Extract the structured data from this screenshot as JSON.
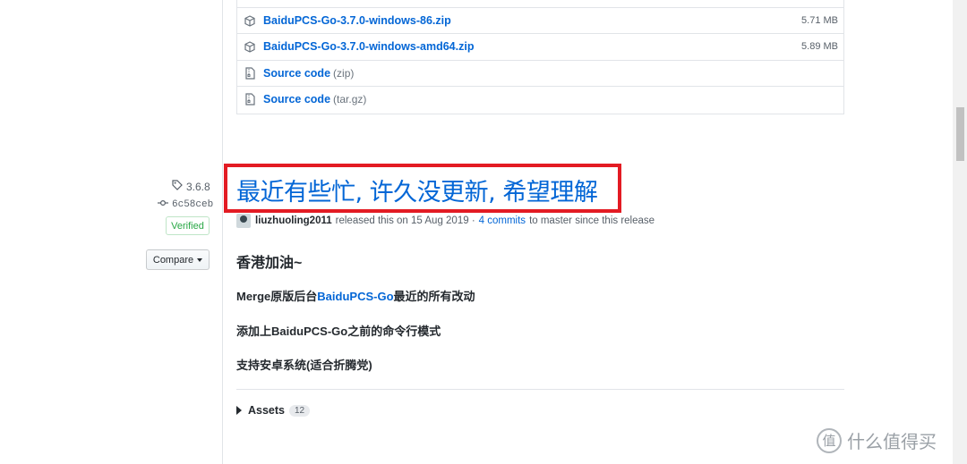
{
  "prev_assets": [
    {
      "name": "BaiduPCS-Go-3.7.0-windows-86.zip",
      "size": "5.71 MB",
      "icon": "package-icon"
    },
    {
      "name": "BaiduPCS-Go-3.7.0-windows-amd64.zip",
      "size": "5.89 MB",
      "icon": "package-icon"
    },
    {
      "name": "Source code",
      "format": "(zip)",
      "icon": "file-zip-icon"
    },
    {
      "name": "Source code",
      "format": "(tar.gz)",
      "icon": "file-zip-icon"
    }
  ],
  "release": {
    "tag": "3.6.8",
    "commit": "6c58ceb",
    "verified": "Verified",
    "compare": "Compare",
    "title": "最近有些忙, 许久没更新, 希望理解",
    "author": "liuzhuoling2011",
    "released_text": "released this on 15 Aug 2019 ·",
    "commits_link": "4 commits",
    "commits_suffix": "to master since this release",
    "body": {
      "heading": "香港加油~",
      "line1_prefix": "Merge原版后台",
      "line1_link": "BaiduPCS-Go",
      "line1_suffix": "最近的所有改动",
      "line2": "添加上BaiduPCS-Go之前的命令行模式",
      "line3": "支持安卓系统(适合折腾党)"
    },
    "assets_label": "Assets",
    "assets_count": "12"
  },
  "watermark": {
    "mark": "值",
    "text": "什么值得买"
  },
  "colors": {
    "link": "#0366d6",
    "highlight": "#e31b23",
    "verified": "#28a745"
  }
}
